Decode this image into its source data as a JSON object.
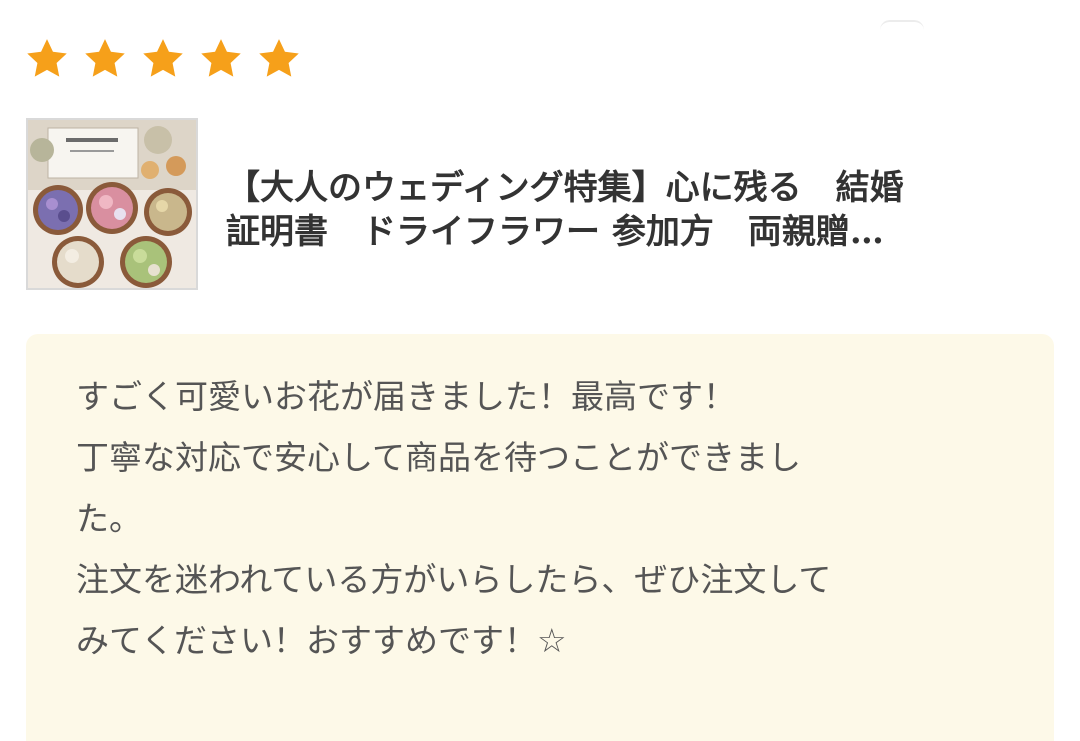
{
  "rating": {
    "stars": 5,
    "max": 5,
    "star_color": "#f6a01a",
    "icon": "star-icon"
  },
  "product": {
    "title_line1": "【大人のウェディング特集】心に残る　結婚",
    "title_line2": "証明書　ドライフラワー  参加方　両親贈…",
    "thumbnail_icon": "product-photo-dried-flowers"
  },
  "review": {
    "background": "#fdf9e8",
    "lines": [
      "すごく可愛いお花が届きました！最高です！",
      "丁寧な対応で安心して商品を待つことができまし",
      "た。",
      "注文を迷われている方がいらしたら、ぜひ注文して",
      "みてください！おすすめです！☆"
    ]
  }
}
